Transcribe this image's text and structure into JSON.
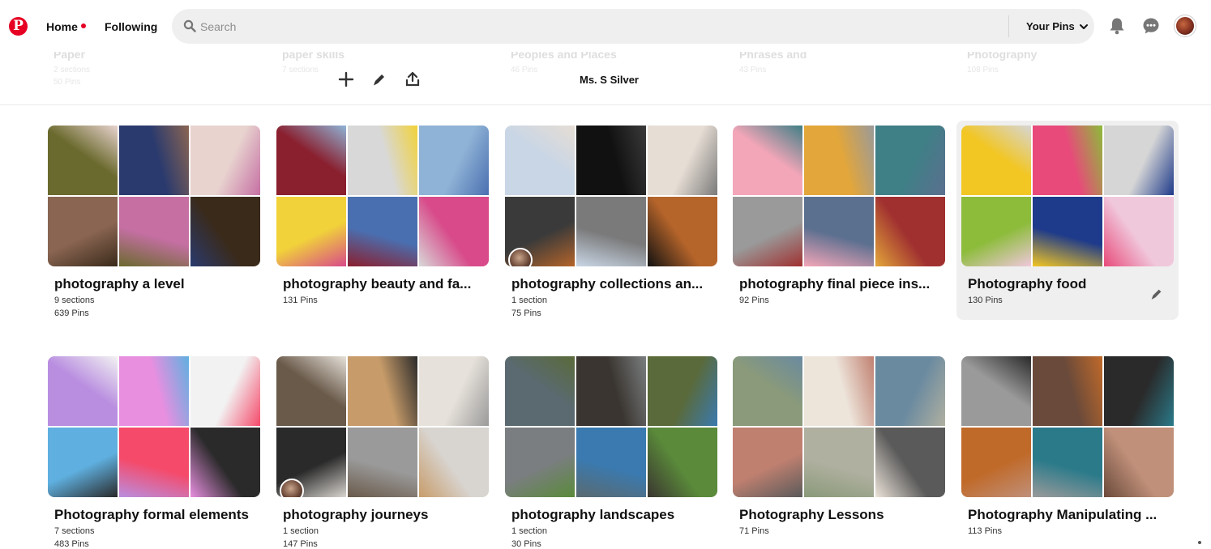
{
  "header": {
    "logo": "P",
    "nav": {
      "home": "Home",
      "following": "Following"
    },
    "search": {
      "placeholder": "Search"
    },
    "your_pins": "Your Pins",
    "icons": [
      "bell-icon",
      "chat-icon"
    ],
    "colors": {
      "brand": "#e60023",
      "search_bg": "#efefef"
    }
  },
  "profile_bar": {
    "name": "Ms. S Silver",
    "actions": [
      "plus-icon",
      "pencil-icon",
      "share-icon"
    ]
  },
  "boards": [
    {
      "title": "photography a level",
      "line1": "9 sections",
      "line2": "639 Pins",
      "palette": [
        "#6b6a2e",
        "#2a3a6e",
        "#e8d3cf",
        "#8a6552",
        "#c56fa3",
        "#3a2a1a"
      ]
    },
    {
      "title": "photography beauty and fa...",
      "line1": "131 Pins",
      "line2": "",
      "palette": [
        "#8a1f2e",
        "#d8d8d8",
        "#8fb3d6",
        "#f1d23a",
        "#4a6fb0",
        "#d84a8a"
      ]
    },
    {
      "title": "photography collections an...",
      "line1": "1 section",
      "line2": "75 Pins",
      "palette": [
        "#c9d6e6",
        "#111111",
        "#e6ddd4",
        "#3a3a3a",
        "#7a7a7a",
        "#b5642a"
      ],
      "collaborator": true
    },
    {
      "title": "photography final piece ins...",
      "line1": "92 Pins",
      "line2": "",
      "palette": [
        "#f3a6b8",
        "#e3a63a",
        "#3f7f86",
        "#9a9a9a",
        "#5b6f8f",
        "#a03030"
      ]
    },
    {
      "title": "Photography food",
      "line1": "130 Pins",
      "line2": "",
      "palette": [
        "#f2c623",
        "#e84a7a",
        "#d6d6d6",
        "#8cbc3a",
        "#1e3a8a",
        "#f0c8dc"
      ],
      "hover": true
    },
    {
      "title": "Photography formal elements",
      "line1": "7 sections",
      "line2": "483 Pins",
      "palette": [
        "#b98ee0",
        "#e88fe0",
        "#f2f2f2",
        "#5fb0e0",
        "#f54a6a",
        "#2a2a2a"
      ]
    },
    {
      "title": "photography journeys",
      "line1": "1 section",
      "line2": "147 Pins",
      "palette": [
        "#6a5a4a",
        "#c79c6a",
        "#e6e1da",
        "#2a2a2a",
        "#9a9a9a",
        "#d8d4cf"
      ],
      "collaborator": true
    },
    {
      "title": "photography landscapes",
      "line1": "1 section",
      "line2": "30 Pins",
      "palette": [
        "#5a6a70",
        "#3a3530",
        "#5a6a3a",
        "#7a7e80",
        "#3a7ab0",
        "#5a8a3a"
      ]
    },
    {
      "title": "Photography Lessons",
      "line1": "71 Pins",
      "line2": "",
      "palette": [
        "#8a9a7a",
        "#ede4da",
        "#6a8aa0",
        "#c08070",
        "#b0b0a0",
        "#5a5a5a"
      ]
    },
    {
      "title": "Photography Manipulating ...",
      "line1": "113 Pins",
      "line2": "",
      "palette": [
        "#9a9a9a",
        "#6a4a3a",
        "#2a2a2a",
        "#c06a2a",
        "#2a7a8a",
        "#c0907a"
      ]
    }
  ],
  "ghost_boards": [
    {
      "title": "Paper",
      "l1": "2 sections",
      "l2": "50 Pins"
    },
    {
      "title": "paper skills",
      "l1": "7 sections",
      "l2": ""
    },
    {
      "title": "Peoples and Places",
      "l1": "46 Pins",
      "l2": ""
    },
    {
      "title": "Phrases and",
      "l1": "43 Pins",
      "l2": ""
    },
    {
      "title": "Photography",
      "l1": "108 Pins",
      "l2": ""
    }
  ]
}
